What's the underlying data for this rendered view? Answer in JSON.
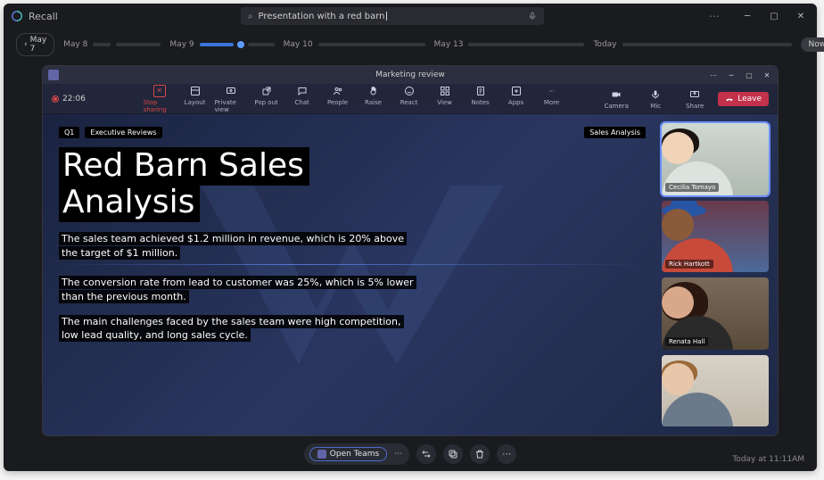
{
  "app": {
    "name": "Recall"
  },
  "search": {
    "query": "Presentation with a red barn",
    "glyph": "⌕",
    "mic": "🎤"
  },
  "timeline": {
    "back": "May 7",
    "labels": [
      "May 8",
      "May 9",
      "May 10",
      "May 13",
      "Today"
    ],
    "now": "Now"
  },
  "teams": {
    "title": "Marketing review",
    "timer": "22:06",
    "toolbar": [
      {
        "id": "stop",
        "label": "Stop sharing"
      },
      {
        "id": "layout",
        "label": "Layout"
      },
      {
        "id": "private",
        "label": "Private view"
      },
      {
        "id": "popout",
        "label": "Pop out"
      },
      {
        "id": "chat",
        "label": "Chat"
      },
      {
        "id": "people",
        "label": "People"
      },
      {
        "id": "raise",
        "label": "Raise"
      },
      {
        "id": "react",
        "label": "React"
      },
      {
        "id": "view",
        "label": "View"
      },
      {
        "id": "notes",
        "label": "Notes"
      },
      {
        "id": "apps",
        "label": "Apps"
      },
      {
        "id": "more",
        "label": "More"
      }
    ],
    "right": {
      "camera": "Camera",
      "mic": "Mic",
      "share": "Share",
      "leave": "Leave"
    }
  },
  "slide": {
    "tags": {
      "q": "Q1",
      "section": "Executive Reviews",
      "topic": "Sales Analysis"
    },
    "title_l1": "Red Barn Sales",
    "title_l2": "Analysis",
    "p1": "The sales team achieved $1.2 million in revenue, which is 20% above the target of $1 million.",
    "p2": "The conversion rate from lead to customer was 25%, which is 5% lower than the previous month.",
    "p3": "The main challenges faced by the sales team were high competition, low lead quality, and long sales cycle."
  },
  "participants": [
    {
      "name": "Cecilia Tomayo"
    },
    {
      "name": "Rick Hartkott"
    },
    {
      "name": "Renata Hall"
    },
    {
      "name": ""
    }
  ],
  "actions": {
    "open": "Open Teams"
  },
  "footer": {
    "timestamp": "Today at 11:11AM"
  }
}
